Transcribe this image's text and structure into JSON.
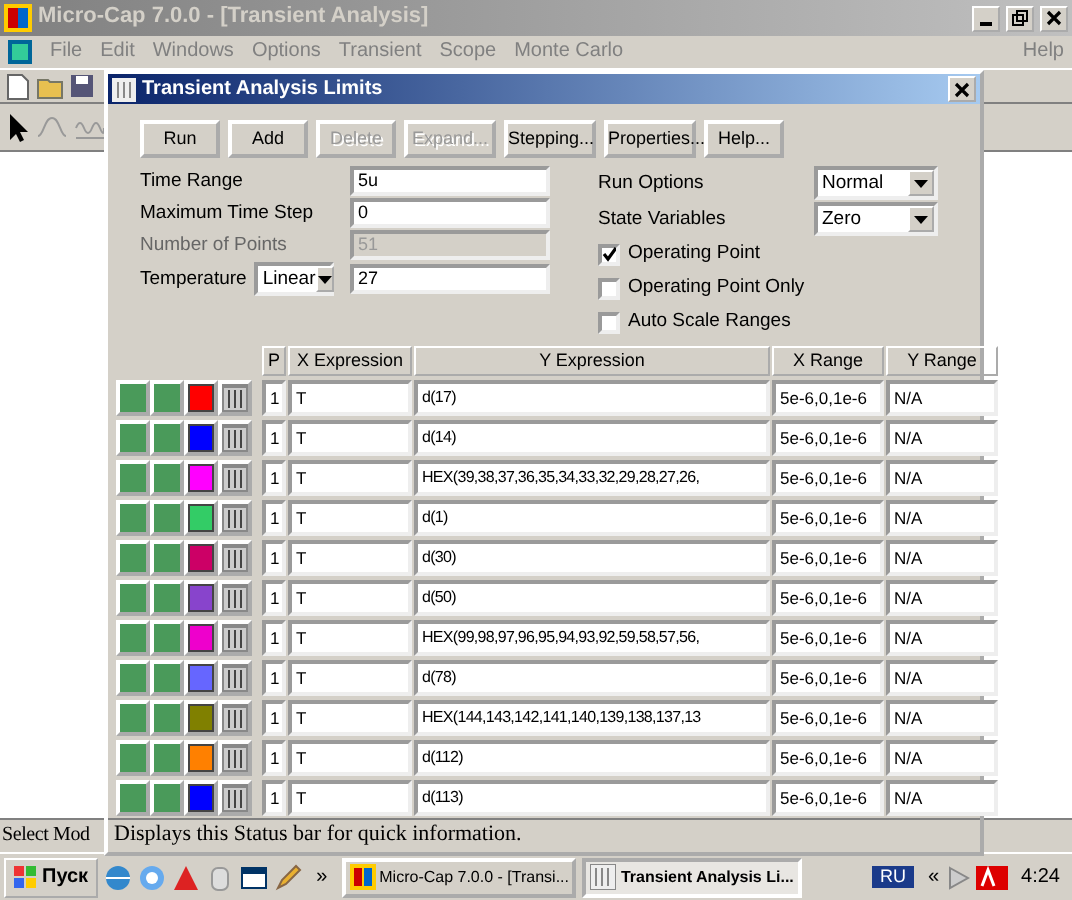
{
  "main_window": {
    "title": "Micro-Cap 7.0.0 - [Transient Analysis]",
    "menu": [
      "File",
      "Edit",
      "Windows",
      "Options",
      "Transient",
      "Scope",
      "Monte Carlo"
    ],
    "help_menu": "Help",
    "status_text": "Select Mod"
  },
  "dialog": {
    "title": "Transient Analysis Limits",
    "buttons": [
      {
        "label": "Run",
        "disabled": false
      },
      {
        "label": "Add",
        "disabled": false
      },
      {
        "label": "Delete",
        "disabled": true
      },
      {
        "label": "Expand...",
        "disabled": true
      },
      {
        "label": "Stepping...",
        "disabled": false
      },
      {
        "label": "Properties...",
        "disabled": false
      },
      {
        "label": "Help...",
        "disabled": false
      }
    ],
    "fields": [
      {
        "kind": "input",
        "label": "Time Range",
        "value": "5u"
      },
      {
        "kind": "input",
        "label": "Maximum Time Step",
        "value": "0"
      },
      {
        "kind": "readonly",
        "label": "Number of Points",
        "value": "51"
      },
      {
        "kind": "select_input",
        "label": "Temperature",
        "option": "Linear",
        "value": "27"
      }
    ],
    "selects": [
      {
        "label": "Run Options",
        "value": "Normal"
      },
      {
        "label": "State Variables",
        "value": "Zero"
      }
    ],
    "checkboxes": [
      {
        "label": "Operating Point",
        "checked": true
      },
      {
        "label": "Operating Point Only",
        "checked": false
      },
      {
        "label": "Auto Scale Ranges",
        "checked": false
      }
    ],
    "table": {
      "columns": [
        "P",
        "X Expression",
        "Y Expression",
        "X Range",
        "Y Range"
      ],
      "rows": [
        {
          "color": "#ff0000",
          "p": "1",
          "x_expression": "T",
          "y_expression": "d(17)",
          "x_range": "5e-6,0,1e-6",
          "y_range": "N/A"
        },
        {
          "color": "#0000ff",
          "p": "1",
          "x_expression": "T",
          "y_expression": "d(14)",
          "x_range": "5e-6,0,1e-6",
          "y_range": "N/A"
        },
        {
          "color": "#ff00ff",
          "p": "1",
          "x_expression": "T",
          "y_expression": "HEX(39,38,37,36,35,34,33,32,29,28,27,26,",
          "x_range": "5e-6,0,1e-6",
          "y_range": "N/A"
        },
        {
          "color": "#33cc66",
          "p": "1",
          "x_expression": "T",
          "y_expression": "d(1)",
          "x_range": "5e-6,0,1e-6",
          "y_range": "N/A"
        },
        {
          "color": "#cc0066",
          "p": "1",
          "x_expression": "T",
          "y_expression": "d(30)",
          "x_range": "5e-6,0,1e-6",
          "y_range": "N/A"
        },
        {
          "color": "#8844cc",
          "p": "1",
          "x_expression": "T",
          "y_expression": "d(50)",
          "x_range": "5e-6,0,1e-6",
          "y_range": "N/A"
        },
        {
          "color": "#ee00cc",
          "p": "1",
          "x_expression": "T",
          "y_expression": "HEX(99,98,97,96,95,94,93,92,59,58,57,56,",
          "x_range": "5e-6,0,1e-6",
          "y_range": "N/A"
        },
        {
          "color": "#6666ff",
          "p": "1",
          "x_expression": "T",
          "y_expression": "d(78)",
          "x_range": "5e-6,0,1e-6",
          "y_range": "N/A"
        },
        {
          "color": "#808000",
          "p": "1",
          "x_expression": "T",
          "y_expression": "HEX(144,143,142,141,140,139,138,137,13",
          "x_range": "5e-6,0,1e-6",
          "y_range": "N/A"
        },
        {
          "color": "#ff8000",
          "p": "1",
          "x_expression": "T",
          "y_expression": "d(112)",
          "x_range": "5e-6,0,1e-6",
          "y_range": "N/A"
        },
        {
          "color": "#0000ff",
          "p": "1",
          "x_expression": "T",
          "y_expression": "d(113)",
          "x_range": "5e-6,0,1e-6",
          "y_range": "N/A"
        }
      ]
    },
    "status": "Displays this Status bar for quick information."
  },
  "taskbar": {
    "start": "Пуск",
    "more": "»",
    "tasks": [
      {
        "label": "Micro-Cap 7.0.0 - [Transi...",
        "selected": false
      },
      {
        "label": "Transient Analysis Li...",
        "selected": true
      }
    ],
    "language": "RU",
    "tray_more": "«",
    "clock": "4:24"
  }
}
